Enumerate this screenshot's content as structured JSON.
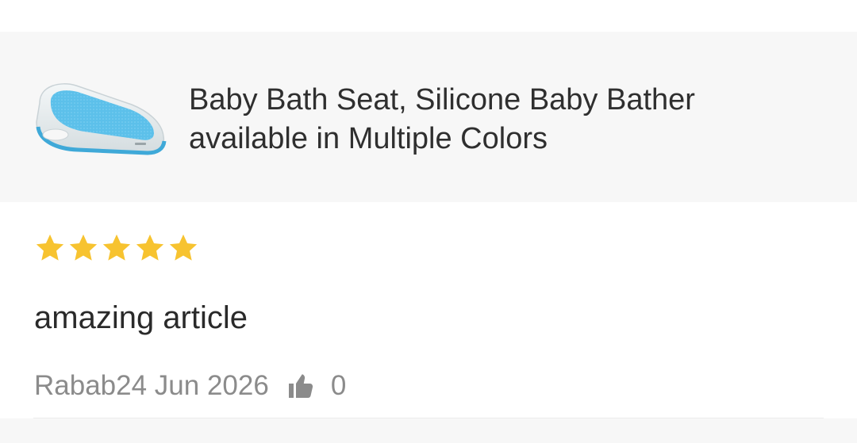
{
  "product": {
    "title_line1": "Baby Bath Seat, Silicone Baby Bather",
    "title_line2": "available in Multiple Colors",
    "image_icon": "baby-bath-seat-image",
    "colors": {
      "seat_blue": "#5cc0ea",
      "seat_frame": "#e9eef0"
    }
  },
  "review": {
    "rating": 5,
    "rating_max": 5,
    "star_color": "#f7c330",
    "text": "amazing article",
    "author_date": "Rabab24 Jun 2026",
    "like_icon": "thumbs-up-icon",
    "like_count": "0"
  }
}
